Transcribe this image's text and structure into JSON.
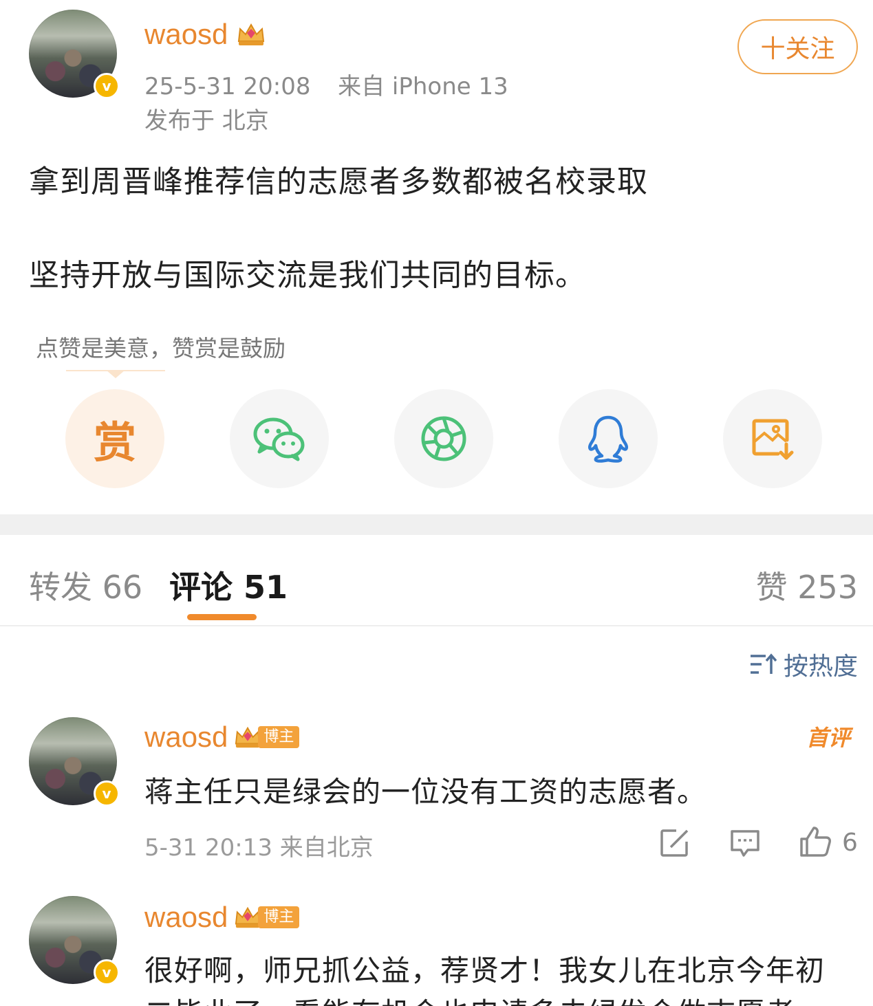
{
  "post": {
    "username": "waosd",
    "timestamp": "25-5-31 20:08",
    "source": "来自 iPhone 13",
    "location": "发布于 北京",
    "follow_label": "十关注",
    "paragraphs": [
      "拿到周晋峰推荐信的志愿者多数都被名校录取",
      "坚持开放与国际交流是我们共同的目标。"
    ]
  },
  "reward": {
    "tip": "点赞是美意，赞赏是鼓励",
    "reward_char": "赏"
  },
  "share_icons": [
    "reward-icon",
    "wechat-icon",
    "moments-icon",
    "qq-icon",
    "save-image-icon"
  ],
  "tabs": {
    "repost": "转发 66",
    "comment": "评论 51",
    "like": "赞 253"
  },
  "sort": {
    "label": "按热度"
  },
  "comments": [
    {
      "username": "waosd",
      "badge": "博主",
      "first_badge": "首评",
      "text": "蒋主任只是绿会的一位没有工资的志愿者。",
      "meta": "5-31 20:13  来自北京",
      "likes": "6"
    },
    {
      "username": "waosd",
      "badge": "博主",
      "text": "很好啊，师兄抓公益，荐贤才！我女儿在北京今年初",
      "text_line2": "二毕业了，看能有机会也申请多去绿发会做志愿者"
    }
  ],
  "colors": {
    "accent": "#e8872f",
    "link": "#516f95",
    "wechat": "#4cc178",
    "qq": "#2f7cd6",
    "verified": "#f6b600"
  }
}
